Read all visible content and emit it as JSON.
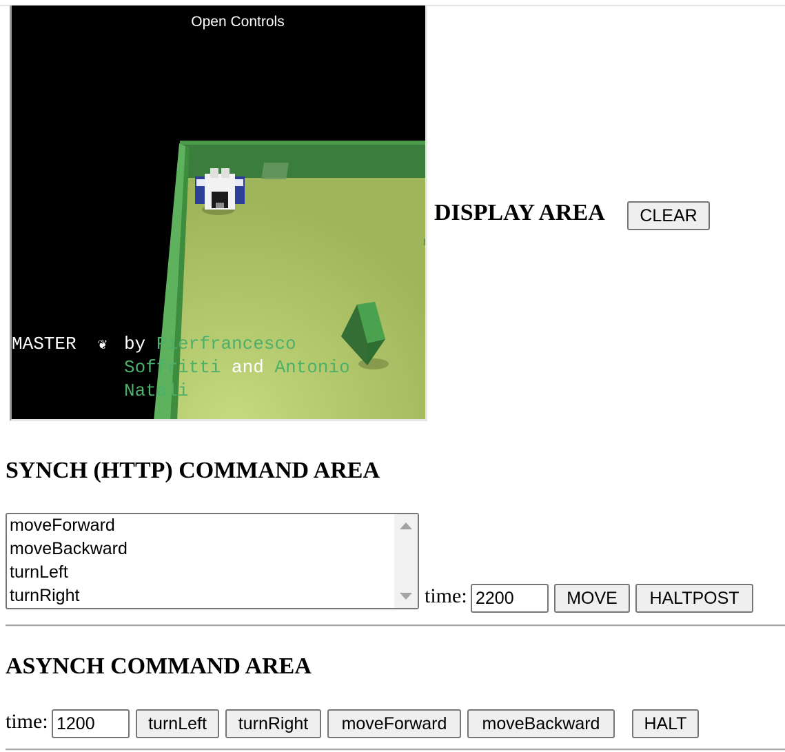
{
  "scene": {
    "open_controls": "Open Controls",
    "credits": {
      "master": "MASTER",
      "by": "by",
      "author1": "Pierfrancesco",
      "author1_last": "Soffritti",
      "and": "and",
      "author2": "Antonio",
      "author2_last": "Natali"
    }
  },
  "display": {
    "title": "DISPLAY AREA",
    "clear_label": "CLEAR"
  },
  "synch": {
    "title": "SYNCH (HTTP) COMMAND AREA",
    "commands": [
      "moveForward",
      "moveBackward",
      "turnLeft",
      "turnRight"
    ],
    "time_label": "time:",
    "time_value": "2200",
    "move_label": "MOVE",
    "haltpost_label": "HALTPOST"
  },
  "asynch": {
    "title": "ASYNCH COMMAND AREA",
    "time_label": "time:",
    "time_value": "1200",
    "buttons": [
      "turnLeft",
      "turnRight",
      "moveForward",
      "moveBackward"
    ],
    "halt_label": "HALT"
  },
  "colors": {
    "floor": "#a9bf63",
    "wall": "#3a7d3c",
    "obstacle": "#4aa24f",
    "credit_green": "#4caf6a"
  }
}
